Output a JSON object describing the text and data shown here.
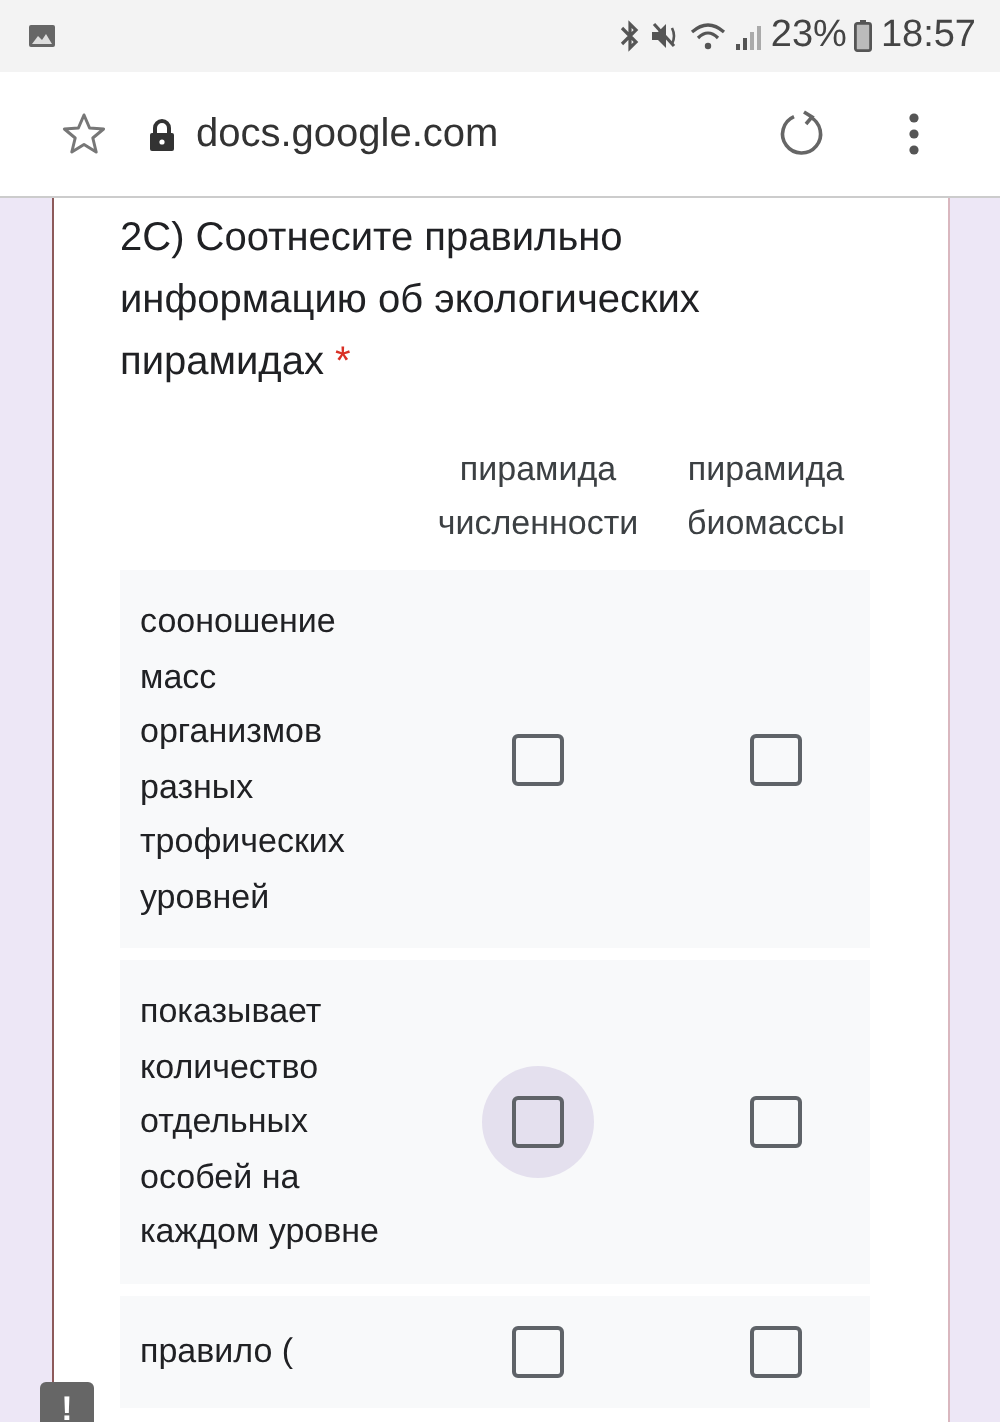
{
  "status_bar": {
    "battery": "23%",
    "time": "18:57"
  },
  "address_bar": {
    "url": "docs.google.com"
  },
  "question": {
    "title": "2С) Соотнесите правильно информацию об экологических пирамидах",
    "required_mark": "*",
    "has_error": true,
    "columns": [
      "пирамида численности",
      "пирамида биомассы"
    ],
    "rows": [
      {
        "label": "сооношение масс организмов разных трофических уровней",
        "cells": [
          {
            "checked": false,
            "focused": false
          },
          {
            "checked": false,
            "focused": false
          }
        ]
      },
      {
        "label": "показывает количество отдельных особей на каждом уровне",
        "cells": [
          {
            "checked": false,
            "focused": true
          },
          {
            "checked": false,
            "focused": false
          }
        ]
      },
      {
        "label": "правило (",
        "cells": [
          {
            "checked": false,
            "focused": false
          },
          {
            "checked": false,
            "focused": false
          }
        ]
      }
    ]
  },
  "error_badge": {
    "text": "!"
  }
}
